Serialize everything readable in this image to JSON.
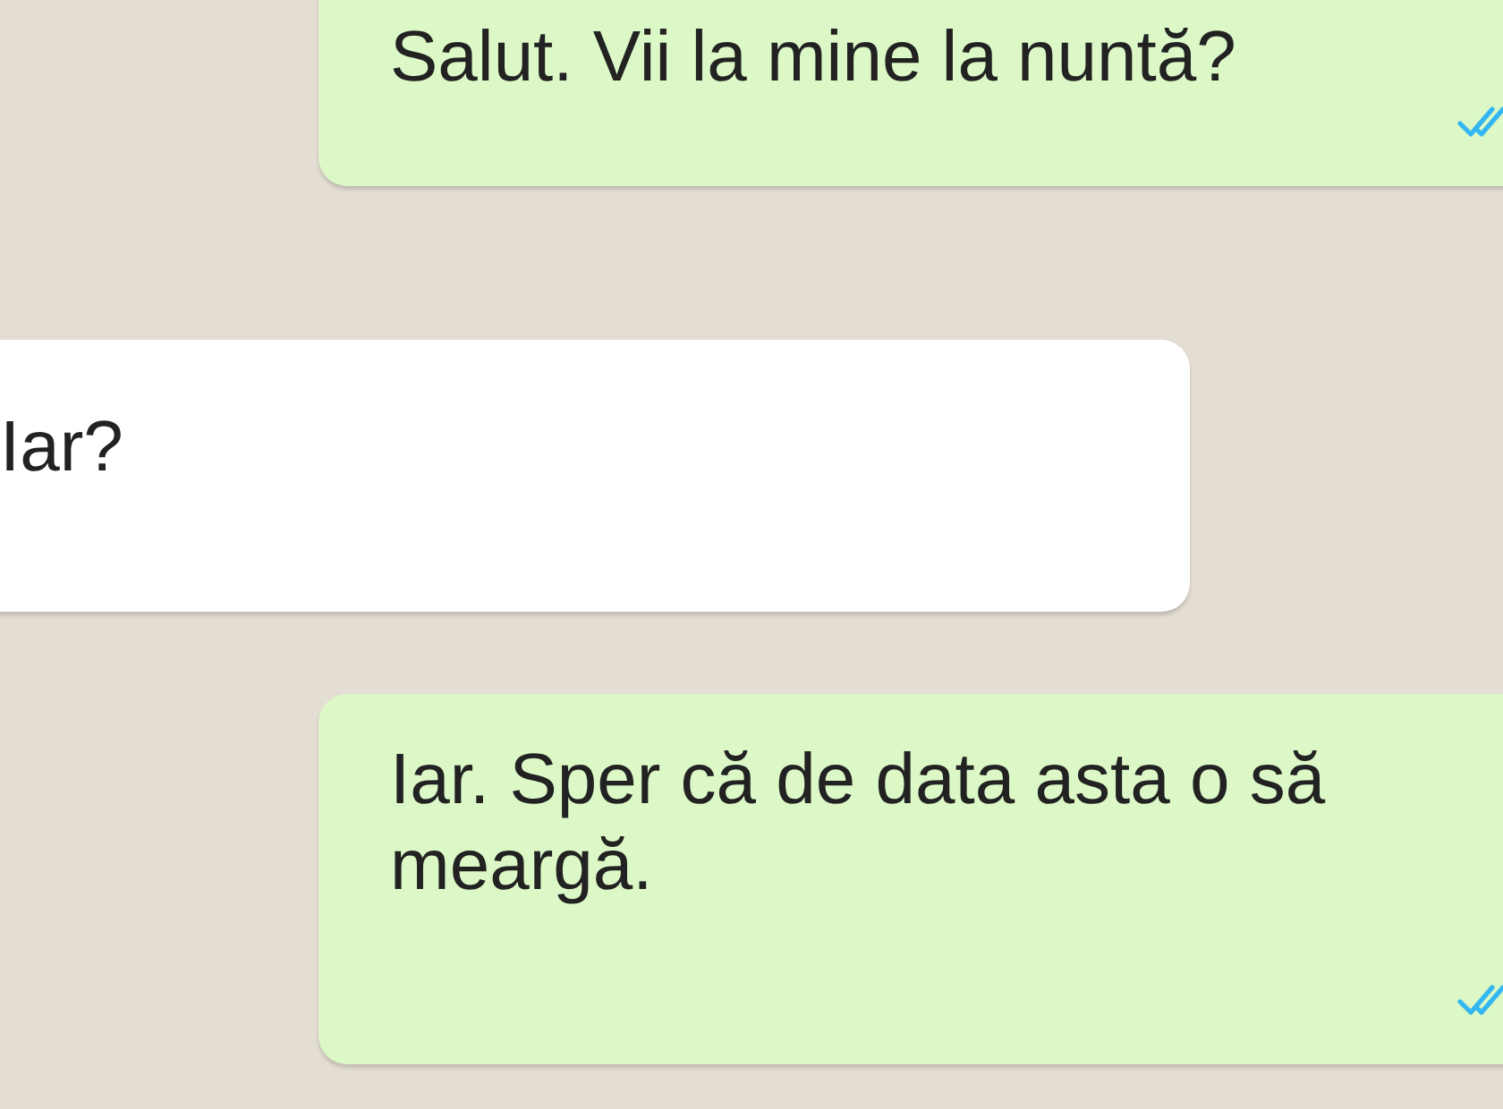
{
  "messages": [
    {
      "kind": "outgoing",
      "text": "Salut. Vii la mine la nuntă?",
      "read": true
    },
    {
      "kind": "incoming",
      "text": "Iar?"
    },
    {
      "kind": "outgoing",
      "text": "Iar. Sper că de data asta o să meargă.",
      "read": true
    }
  ]
}
